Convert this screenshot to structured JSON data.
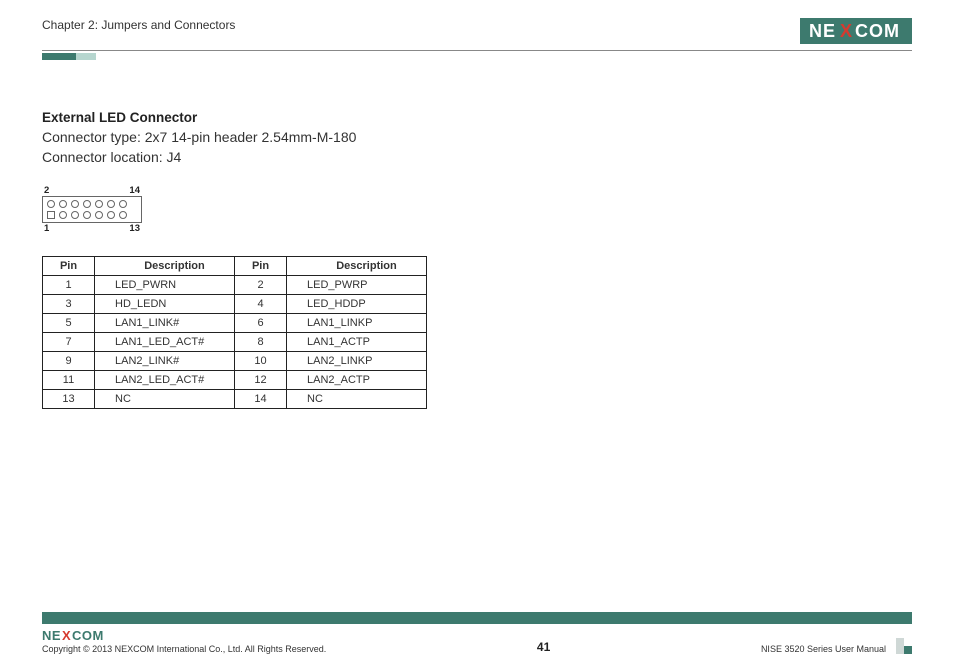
{
  "brand": {
    "name": "NEXCOM",
    "name_prefix": "NE",
    "name_mid": "X",
    "name_suffix": "COM"
  },
  "header": {
    "chapter": "Chapter 2: Jumpers and Connectors"
  },
  "section": {
    "title": "External LED Connector",
    "type_label": "Connector type:",
    "type_value": "2x7 14-pin header 2.54mm-M-180",
    "location_label": "Connector location:",
    "location_value": "J4"
  },
  "pin_diagram": {
    "top_left": "2",
    "top_right": "14",
    "bottom_left": "1",
    "bottom_right": "13",
    "columns": 7
  },
  "pin_table": {
    "headers": {
      "pin": "Pin",
      "desc": "Description"
    },
    "rows": [
      {
        "pin_a": "1",
        "desc_a": "LED_PWRN",
        "pin_b": "2",
        "desc_b": "LED_PWRP"
      },
      {
        "pin_a": "3",
        "desc_a": "HD_LEDN",
        "pin_b": "4",
        "desc_b": "LED_HDDP"
      },
      {
        "pin_a": "5",
        "desc_a": "LAN1_LINK#",
        "pin_b": "6",
        "desc_b": "LAN1_LINKP"
      },
      {
        "pin_a": "7",
        "desc_a": "LAN1_LED_ACT#",
        "pin_b": "8",
        "desc_b": "LAN1_ACTP"
      },
      {
        "pin_a": "9",
        "desc_a": "LAN2_LINK#",
        "pin_b": "10",
        "desc_b": "LAN2_LINKP"
      },
      {
        "pin_a": "11",
        "desc_a": "LAN2_LED_ACT#",
        "pin_b": "12",
        "desc_b": "LAN2_ACTP"
      },
      {
        "pin_a": "13",
        "desc_a": "NC",
        "pin_b": "14",
        "desc_b": "NC"
      }
    ]
  },
  "footer": {
    "copyright": "Copyright © 2013 NEXCOM International Co., Ltd. All Rights Reserved.",
    "page_number": "41",
    "manual": "NISE 3520 Series User Manual"
  },
  "colors": {
    "accent": "#3d7a6e",
    "accent_light": "#b6d6cf",
    "x_red": "#d63a2f"
  }
}
